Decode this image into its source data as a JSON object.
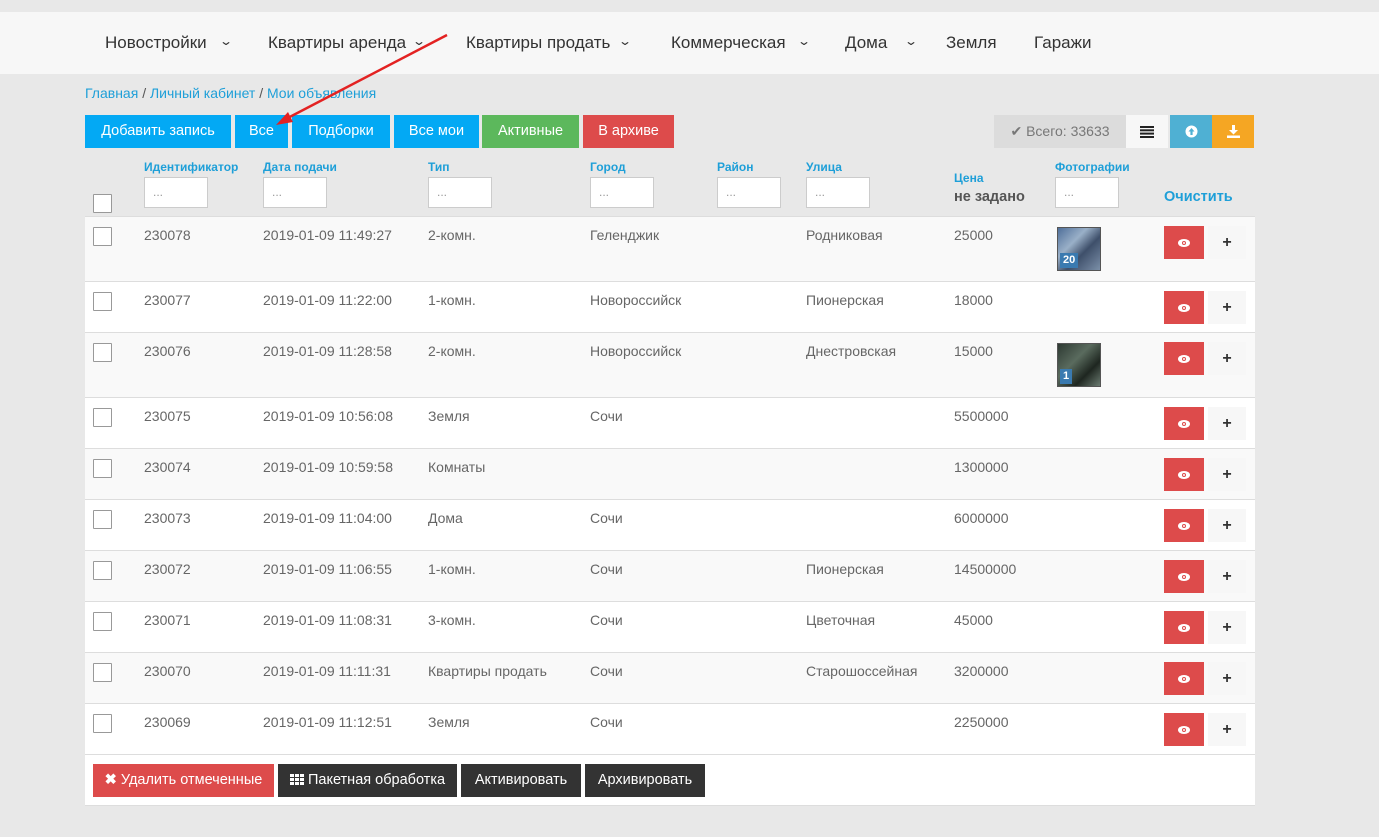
{
  "nav": [
    {
      "label": "Новостройки",
      "dropdown": true
    },
    {
      "label": "Квартиры аренда",
      "dropdown": true
    },
    {
      "label": "Квартиры продать",
      "dropdown": true
    },
    {
      "label": "Коммерческая",
      "dropdown": true
    },
    {
      "label": "Дома",
      "dropdown": true
    },
    {
      "label": "Земля",
      "dropdown": false
    },
    {
      "label": "Гаражи",
      "dropdown": false
    }
  ],
  "breadcrumb": {
    "home": "Главная",
    "cabinet": "Личный кабинет",
    "current": "Мои объявления",
    "sep": "/"
  },
  "toolbar": {
    "add": "Добавить запись",
    "all": "Все",
    "collections": "Подборки",
    "all_mine": "Все мои",
    "active": "Активные",
    "archive": "В архиве",
    "total": "Всего: 33633"
  },
  "columns": {
    "id": "Идентификатор",
    "date": "Дата подачи",
    "type": "Тип",
    "city": "Город",
    "district": "Район",
    "street": "Улица",
    "price": "Цена",
    "price_filter": "не задано",
    "photos": "Фотографии",
    "clear": "Очистить",
    "filter_placeholder": "..."
  },
  "rows": [
    {
      "id": "230078",
      "date": "2019-01-09 11:49:27",
      "type": "2-комн.",
      "city": "Геленджик",
      "street": "Родниковая",
      "price": "25000",
      "photos": "20"
    },
    {
      "id": "230077",
      "date": "2019-01-09 11:22:00",
      "type": "1-комн.",
      "city": "Новороссийск",
      "street": "Пионерская",
      "price": "18000",
      "photos": ""
    },
    {
      "id": "230076",
      "date": "2019-01-09 11:28:58",
      "type": "2-комн.",
      "city": "Новороссийск",
      "street": "Днестровская",
      "price": "15000",
      "photos": "1"
    },
    {
      "id": "230075",
      "date": "2019-01-09 10:56:08",
      "type": "Земля",
      "city": "Сочи",
      "street": "",
      "price": "5500000",
      "photos": ""
    },
    {
      "id": "230074",
      "date": "2019-01-09 10:59:58",
      "type": "Комнаты",
      "city": "",
      "street": "",
      "price": "1300000",
      "photos": ""
    },
    {
      "id": "230073",
      "date": "2019-01-09 11:04:00",
      "type": "Дома",
      "city": "Сочи",
      "street": "",
      "price": "6000000",
      "photos": ""
    },
    {
      "id": "230072",
      "date": "2019-01-09 11:06:55",
      "type": "1-комн.",
      "city": "Сочи",
      "street": "Пионерская",
      "price": "14500000",
      "photos": ""
    },
    {
      "id": "230071",
      "date": "2019-01-09 11:08:31",
      "type": "3-комн.",
      "city": "Сочи",
      "street": "Цветочная",
      "price": "45000",
      "photos": ""
    },
    {
      "id": "230070",
      "date": "2019-01-09 11:11:31",
      "type": "Квартиры продать",
      "city": "Сочи",
      "street": "Старошоссейная",
      "price": "3200000",
      "photos": ""
    },
    {
      "id": "230069",
      "date": "2019-01-09 11:12:51",
      "type": "Земля",
      "city": "Сочи",
      "street": "",
      "price": "2250000",
      "photos": ""
    }
  ],
  "footer": {
    "delete": "Удалить отмеченные",
    "batch": "Пакетная обработка",
    "activate": "Активировать",
    "archive": "Архивировать"
  },
  "colors": {
    "blue": "#03a9f4",
    "green": "#5cb85c",
    "red": "#dd4b4b",
    "dark": "#333333",
    "link": "#1e9fd8",
    "info": "#4fb0d3",
    "orange": "#f5a623",
    "annotation_arrow": "#e32222"
  }
}
